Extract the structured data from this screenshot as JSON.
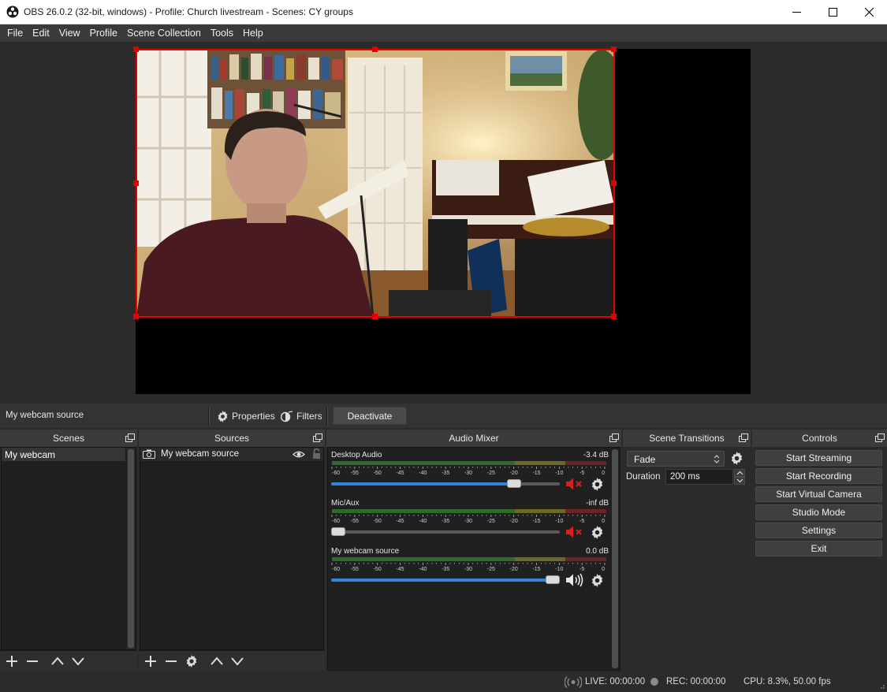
{
  "window": {
    "title": "OBS 26.0.2 (32-bit, windows) - Profile: Church livestream - Scenes: CY groups"
  },
  "menu": [
    "File",
    "Edit",
    "View",
    "Profile",
    "Scene Collection",
    "Tools",
    "Help"
  ],
  "source_toolbar": {
    "selected_source": "My webcam source",
    "properties_label": "Properties",
    "filters_label": "Filters",
    "deactivate_label": "Deactivate"
  },
  "scenes": {
    "title": "Scenes",
    "items": [
      "My webcam"
    ]
  },
  "sources": {
    "title": "Sources",
    "items": [
      {
        "name": "My webcam source",
        "icon": "camera-icon",
        "visible": true,
        "locked": false
      }
    ]
  },
  "audio_mixer": {
    "title": "Audio Mixer",
    "scale": [
      "-60",
      "-55",
      "-50",
      "-45",
      "-40",
      "-35",
      "-30",
      "-25",
      "-20",
      "-15",
      "-10",
      "-5",
      "0"
    ],
    "channels": [
      {
        "name": "Desktop Audio",
        "db": "-3.4 dB",
        "volume": 0.82,
        "muted": true
      },
      {
        "name": "Mic/Aux",
        "db": "-inf dB",
        "volume": 0.0,
        "muted": true
      },
      {
        "name": "My webcam source",
        "db": "0.0 dB",
        "volume": 1.0,
        "muted": false
      }
    ]
  },
  "scene_transitions": {
    "title": "Scene Transitions",
    "transition": "Fade",
    "duration_label": "Duration",
    "duration_value": "200 ms"
  },
  "controls": {
    "title": "Controls",
    "buttons": [
      "Start Streaming",
      "Start Recording",
      "Start Virtual Camera",
      "Studio Mode",
      "Settings",
      "Exit"
    ]
  },
  "status": {
    "live": "LIVE: 00:00:00",
    "rec": "REC: 00:00:00",
    "cpu": "CPU: 8.3%, 50.00 fps"
  },
  "colors": {
    "accent_blue": "#2f86d6",
    "selection_red": "#e60000",
    "mute_red": "#d42020"
  }
}
